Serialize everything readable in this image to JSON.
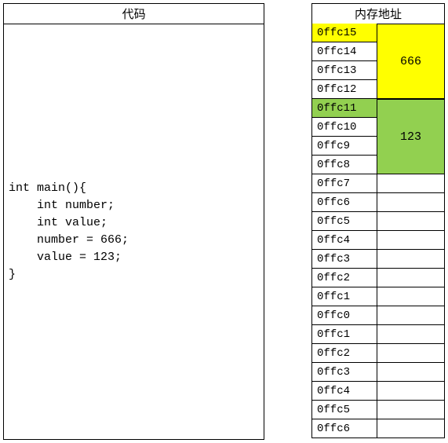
{
  "code_panel": {
    "header": "代码",
    "lines": [
      "int main(){",
      "    int number;",
      "    int value;",
      "    number = 666;",
      "    value = 123;",
      "}"
    ]
  },
  "memory_panel": {
    "header": "内存地址",
    "blocks": [
      {
        "color": "yellow",
        "value": "666",
        "addresses": [
          "0ffc15",
          "0ffc14",
          "0ffc13",
          "0ffc12"
        ],
        "highlight_first": true
      },
      {
        "color": "green",
        "value": "123",
        "addresses": [
          "0ffc11",
          "0ffc10",
          "0ffc9",
          "0ffc8"
        ],
        "highlight_first": true
      }
    ],
    "empty_addresses": [
      "0ffc7",
      "0ffc6",
      "0ffc5",
      "0ffc4",
      "0ffc3",
      "0ffc2",
      "0ffc1",
      "0ffc0",
      "0ffc1",
      "0ffc2",
      "0ffc3",
      "0ffc4",
      "0ffc5",
      "0ffc6"
    ]
  },
  "colors": {
    "yellow": "#ffff00",
    "green": "#92d050"
  }
}
